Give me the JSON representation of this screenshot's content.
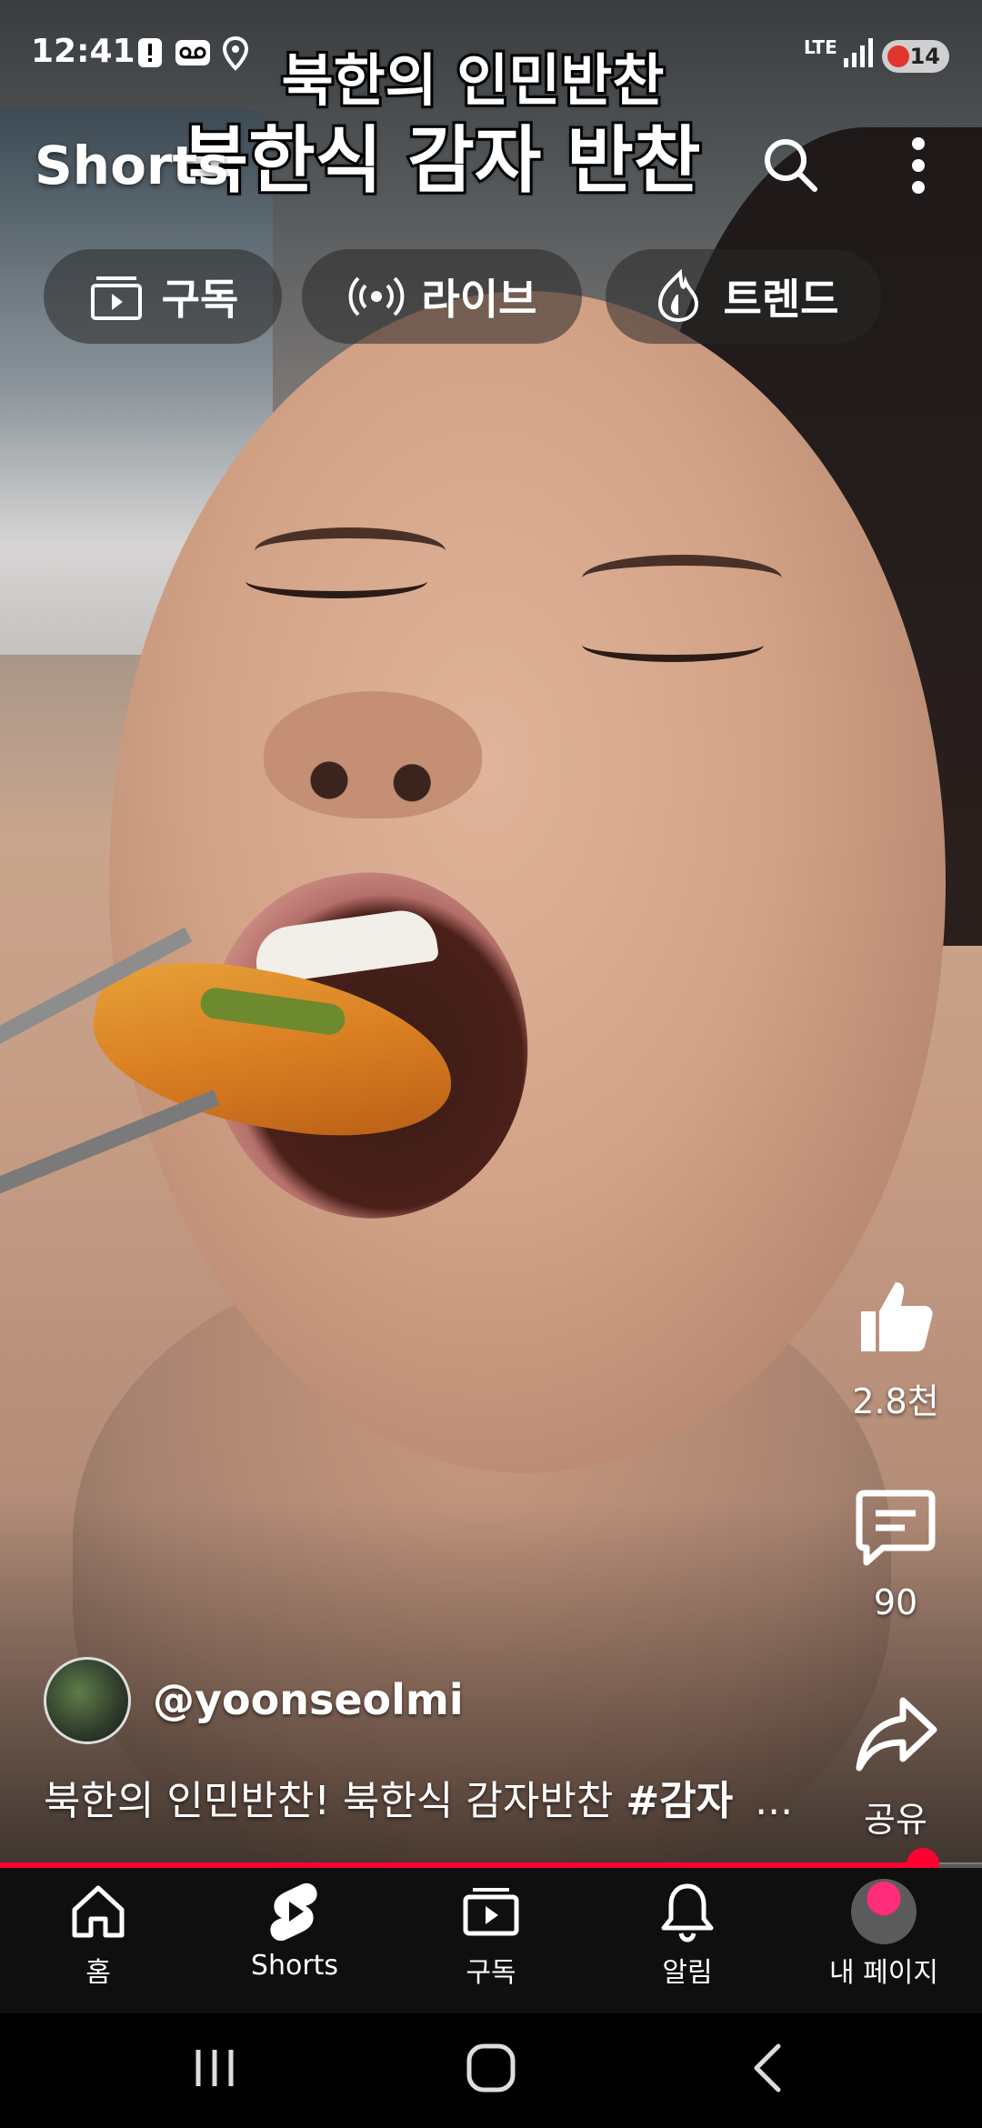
{
  "status_bar": {
    "time": "12:41",
    "network": "LTE",
    "battery": "14",
    "icons": [
      "alert-icon",
      "voicemail-icon",
      "location-icon",
      "signal-icon"
    ]
  },
  "video_overlay": {
    "line1": "북한의 인민반찬",
    "line2": "북한식 감자 반찬"
  },
  "header": {
    "title": "Shorts",
    "icons": [
      "search-icon",
      "more-vert-icon"
    ]
  },
  "chips": [
    {
      "label": "구독",
      "icon": "subscriptions-icon"
    },
    {
      "label": "라이브",
      "icon": "live-icon"
    },
    {
      "label": "트렌드",
      "icon": "trending-icon"
    }
  ],
  "actions": {
    "like_count": "2.8천",
    "comment_count": "90",
    "share_label": "공유"
  },
  "channel": {
    "handle": "@yoonseolmi"
  },
  "caption": {
    "text": "북한의 인민반찬! 북한식 감자반찬 ",
    "hashtag": "#감자",
    "more": "..."
  },
  "progress": {
    "fraction": 0.94,
    "color": "#ff0033"
  },
  "bottom_nav": [
    {
      "label": "홈",
      "icon": "home-icon"
    },
    {
      "label": "Shorts",
      "icon": "shorts-icon"
    },
    {
      "label": "구독",
      "icon": "subscriptions-icon"
    },
    {
      "label": "알림",
      "icon": "bell-icon"
    },
    {
      "label": "내 페이지",
      "icon": "profile-avatar"
    }
  ],
  "system_nav": [
    "recents-icon",
    "home-circle-icon",
    "back-icon"
  ]
}
